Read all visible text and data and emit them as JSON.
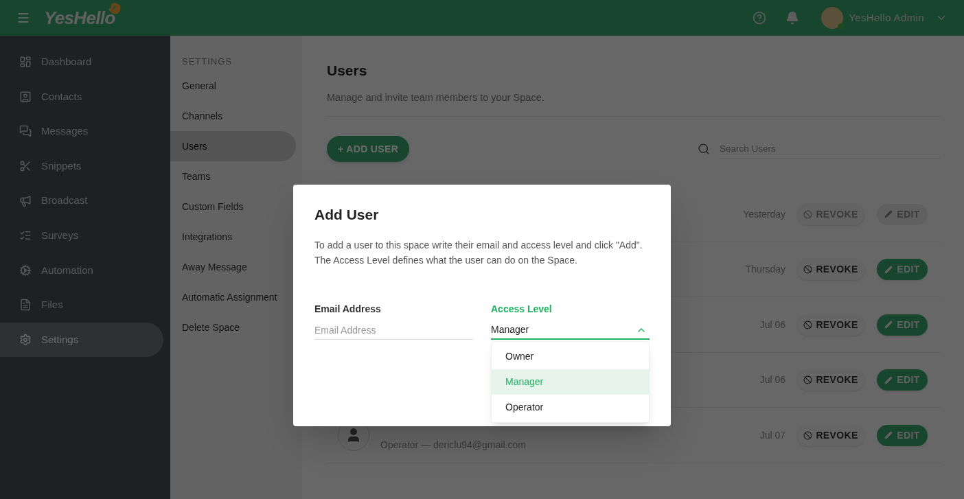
{
  "topbar": {
    "logo": "YesHello",
    "user_name": "YesHello Admin"
  },
  "sidebar": {
    "items": [
      {
        "label": "Dashboard",
        "selected": false
      },
      {
        "label": "Contacts",
        "selected": false
      },
      {
        "label": "Messages",
        "selected": false
      },
      {
        "label": "Snippets",
        "selected": false
      },
      {
        "label": "Broadcast",
        "selected": false
      },
      {
        "label": "Surveys",
        "selected": false
      },
      {
        "label": "Automation",
        "selected": false
      },
      {
        "label": "Files",
        "selected": false
      },
      {
        "label": "Settings",
        "selected": true
      }
    ]
  },
  "settings_nav": {
    "heading": "SETTINGS",
    "items": [
      {
        "label": "General",
        "selected": false
      },
      {
        "label": "Channels",
        "selected": false
      },
      {
        "label": "Users",
        "selected": true
      },
      {
        "label": "Teams",
        "selected": false
      },
      {
        "label": "Custom Fields",
        "selected": false
      },
      {
        "label": "Integrations",
        "selected": false
      },
      {
        "label": "Away Message",
        "selected": false
      },
      {
        "label": "Automatic Assignment",
        "selected": false
      },
      {
        "label": "Delete Space",
        "selected": false
      }
    ]
  },
  "page": {
    "title": "Users",
    "subtitle": "Manage and invite team members to your Space.",
    "add_button": "+ ADD USER",
    "search": {
      "placeholder": "Search Users"
    },
    "rows": [
      {
        "date": "Yesterday",
        "revoke": "REVOKE",
        "edit": "EDIT",
        "disabled": true
      },
      {
        "date": "Thursday",
        "revoke": "REVOKE",
        "edit": "EDIT",
        "disabled": false
      },
      {
        "date": "Jul 06",
        "revoke": "REVOKE",
        "edit": "EDIT",
        "disabled": false
      },
      {
        "date": "Jul 06",
        "revoke": "REVOKE",
        "edit": "EDIT",
        "disabled": false
      },
      {
        "date": "Jul 07",
        "revoke": "REVOKE",
        "edit": "EDIT",
        "disabled": false,
        "detail": "Operator — dericlu94@gmail.com"
      }
    ]
  },
  "dialog": {
    "title": "Add User",
    "text": "To add a user to this space write their email and access level and click \"Add\". The Access Level defines what the user can do on the Space.",
    "email": {
      "label": "Email Address",
      "placeholder": "Email Address"
    },
    "access_level": {
      "label": "Access Level",
      "value": "Manager",
      "open": true,
      "options": [
        {
          "label": "Owner",
          "selected": false
        },
        {
          "label": "Manager",
          "selected": true
        },
        {
          "label": "Operator",
          "selected": false
        }
      ]
    }
  }
}
